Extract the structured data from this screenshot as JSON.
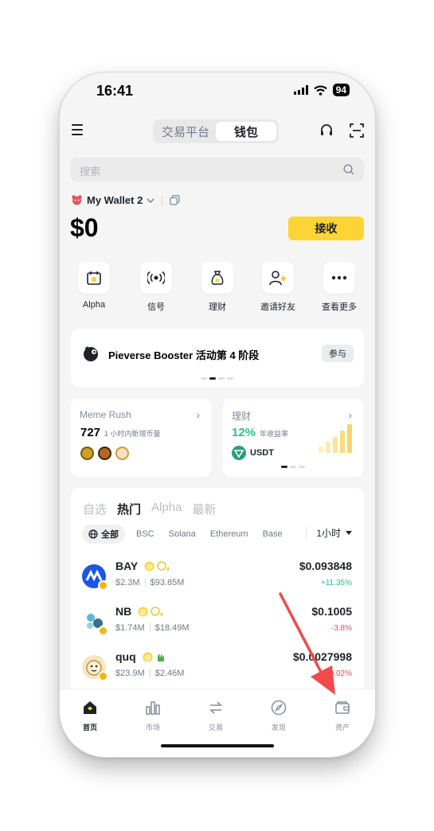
{
  "status": {
    "time": "16:41",
    "battery": "94"
  },
  "header": {
    "seg_exchange": "交易平台",
    "seg_wallet": "钱包"
  },
  "search": {
    "placeholder": "搜索"
  },
  "wallet": {
    "name": "My Wallet 2",
    "balance": "$0",
    "receive_label": "接收"
  },
  "quick_actions": [
    {
      "label": "Alpha",
      "icon": "calendar-alpha-icon"
    },
    {
      "label": "信号",
      "icon": "signal-icon"
    },
    {
      "label": "理财",
      "icon": "money-bag-icon"
    },
    {
      "label": "邀请好友",
      "icon": "add-user-icon"
    },
    {
      "label": "查看更多",
      "icon": "more-icon"
    }
  ],
  "banner": {
    "title": "Pieverse Booster 活动第 4 阶段",
    "join_label": "参与"
  },
  "meme_card": {
    "title": "Meme Rush",
    "count": "727",
    "count_label": "1 小时内新增币量"
  },
  "earn_card": {
    "title": "理财",
    "apr": "12%",
    "apr_label": "年收益率",
    "asset": "USDT"
  },
  "tokens": {
    "tabs": [
      "自选",
      "热门",
      "Alpha",
      "最新"
    ],
    "active_tab": "热门",
    "chains": [
      "全部",
      "BSC",
      "Solana",
      "Ethereum",
      "Base"
    ],
    "timeframe": "1小时",
    "rows": [
      {
        "name": "BAY",
        "mcap": "$2.3M",
        "volume": "$93.85M",
        "price": "$0.093848",
        "change": "+11.35%",
        "direction": "up"
      },
      {
        "name": "NB",
        "mcap": "$1.74M",
        "volume": "$18.49M",
        "price": "$0.1005",
        "change": "-3.8%",
        "direction": "down"
      },
      {
        "name": "quq",
        "mcap": "$23.9M",
        "volume": "$2.46M",
        "price": "$0.002",
        "price_tail": "7998",
        "change": "-0.02%",
        "direction": "down"
      }
    ]
  },
  "nav": [
    {
      "label": "首页",
      "icon": "home-icon",
      "active": true
    },
    {
      "label": "市场",
      "icon": "market-chart-icon",
      "active": false
    },
    {
      "label": "交易",
      "icon": "trade-arrows-icon",
      "active": false
    },
    {
      "label": "发现",
      "icon": "compass-icon",
      "active": false
    },
    {
      "label": "资产",
      "icon": "wallet-icon",
      "active": false
    }
  ],
  "colors": {
    "accent_yellow": "#fcd535",
    "up_green": "#2ebd85",
    "down_red": "#f6465d",
    "annotation_red": "#f14a4a"
  }
}
